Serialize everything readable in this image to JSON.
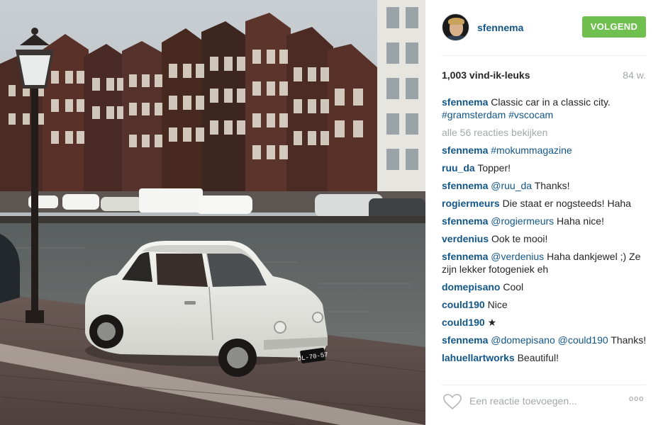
{
  "post": {
    "username": "sfennema",
    "follow_label": "VOLGEND",
    "likes": "1,003 vind-ik-leuks",
    "age": "84 w.",
    "caption_user": "sfennema",
    "caption_text": "Classic car in a classic city.",
    "caption_tags": "#gramsterdam #vscocam",
    "view_all": "alle 56 reacties bekijken",
    "comments": [
      {
        "user": "sfennema",
        "tags": "#mokummagazine",
        "text": ""
      },
      {
        "user": "ruu_da",
        "tags": "",
        "text": "Topper!"
      },
      {
        "user": "sfennema",
        "tags": "@ruu_da",
        "text": "Thanks!"
      },
      {
        "user": "rogiermeurs",
        "tags": "",
        "text": "Die staat er nogsteeds! Haha"
      },
      {
        "user": "sfennema",
        "tags": "@rogiermeurs",
        "text": "Haha nice!"
      },
      {
        "user": "verdenius",
        "tags": "",
        "text": "Ook te mooi!"
      },
      {
        "user": "sfennema",
        "tags": "@verdenius",
        "text": "Haha dankjewel ;) Ze zijn lekker fotogeniek eh"
      },
      {
        "user": "domepisano",
        "tags": "",
        "text": "Cool"
      },
      {
        "user": "could190",
        "tags": "",
        "text": "Nice"
      },
      {
        "user": "could190",
        "tags": "",
        "text": "★"
      },
      {
        "user": "sfennema",
        "tags": "@domepisano @could190",
        "text": "Thanks!"
      },
      {
        "user": "lahuellartworks",
        "tags": "",
        "text": "Beautiful!"
      }
    ],
    "comment_placeholder": "Een reactie toevoegen...",
    "more_label": "ooo",
    "plate": "DL-70-57"
  },
  "colors": {
    "username_blue": "#125688",
    "follow_green": "#70c050",
    "muted_gray": "#a5a7aa"
  },
  "icons": [
    "heart-icon",
    "more-options-icon"
  ]
}
